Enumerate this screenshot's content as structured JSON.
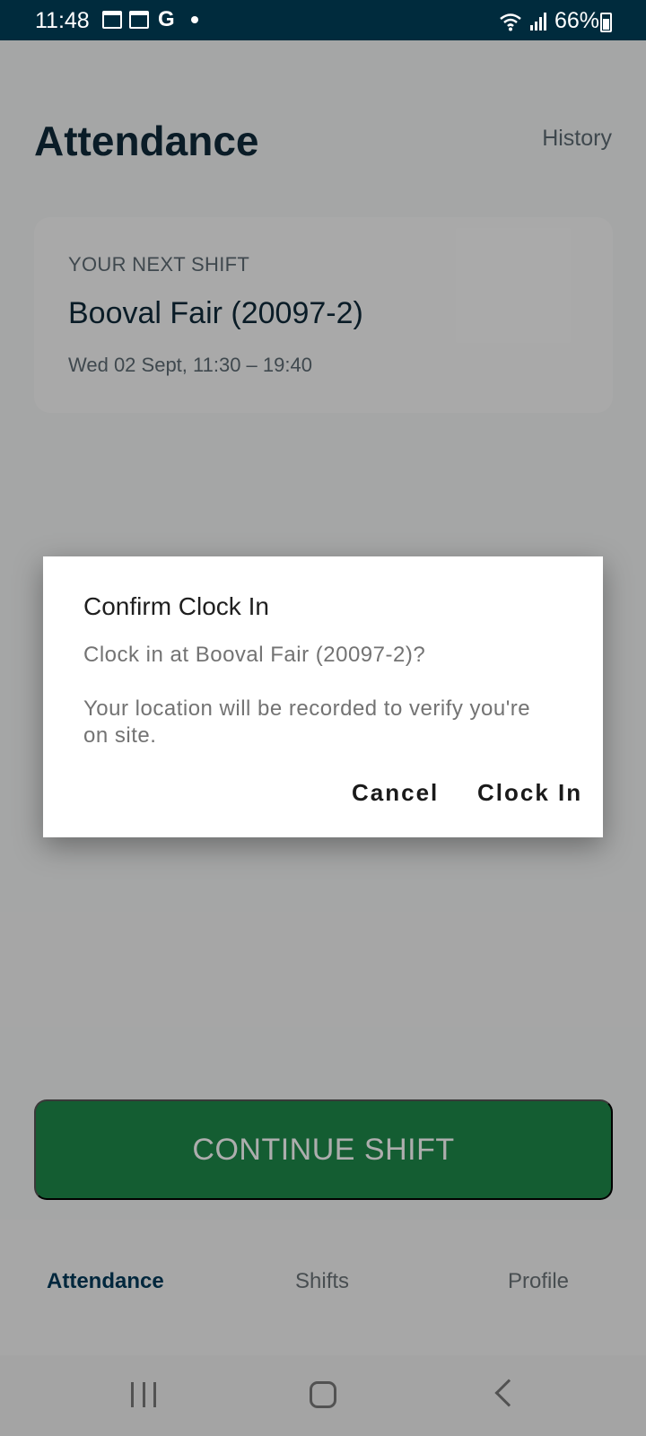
{
  "status_bar": {
    "time": "11:48",
    "g_letter": "G",
    "battery": "66%",
    "icons": [
      "calendar-icon",
      "calendar-icon",
      "google-icon",
      "notification-dot-icon",
      "wifi-icon",
      "signal-icon",
      "battery-icon"
    ]
  },
  "header": {
    "title": "Attendance",
    "history_link": "History"
  },
  "next_shift": {
    "label": "YOUR NEXT SHIFT",
    "site": "Booval Fair (20097-2)",
    "when": "Wed 02 Sept, 11:30 – 19:40"
  },
  "main": {
    "continue_button": "CONTINUE SHIFT",
    "continue_color": "#1e8a4a"
  },
  "bottom_nav": {
    "items": [
      {
        "label": "Attendance",
        "active": true
      },
      {
        "label": "Shifts",
        "active": false
      },
      {
        "label": "Profile",
        "active": false
      }
    ]
  },
  "dialog": {
    "title": "Confirm Clock In",
    "message": "Clock in at Booval Fair (20097-2)?",
    "note": "Your location will be recorded to verify you're on site.",
    "cancel_label": "Cancel",
    "confirm_label": "Clock In"
  },
  "colors": {
    "status_bar": "#002b3d",
    "primary_text": "#0f2a3a",
    "active_nav": "#003a5a"
  }
}
